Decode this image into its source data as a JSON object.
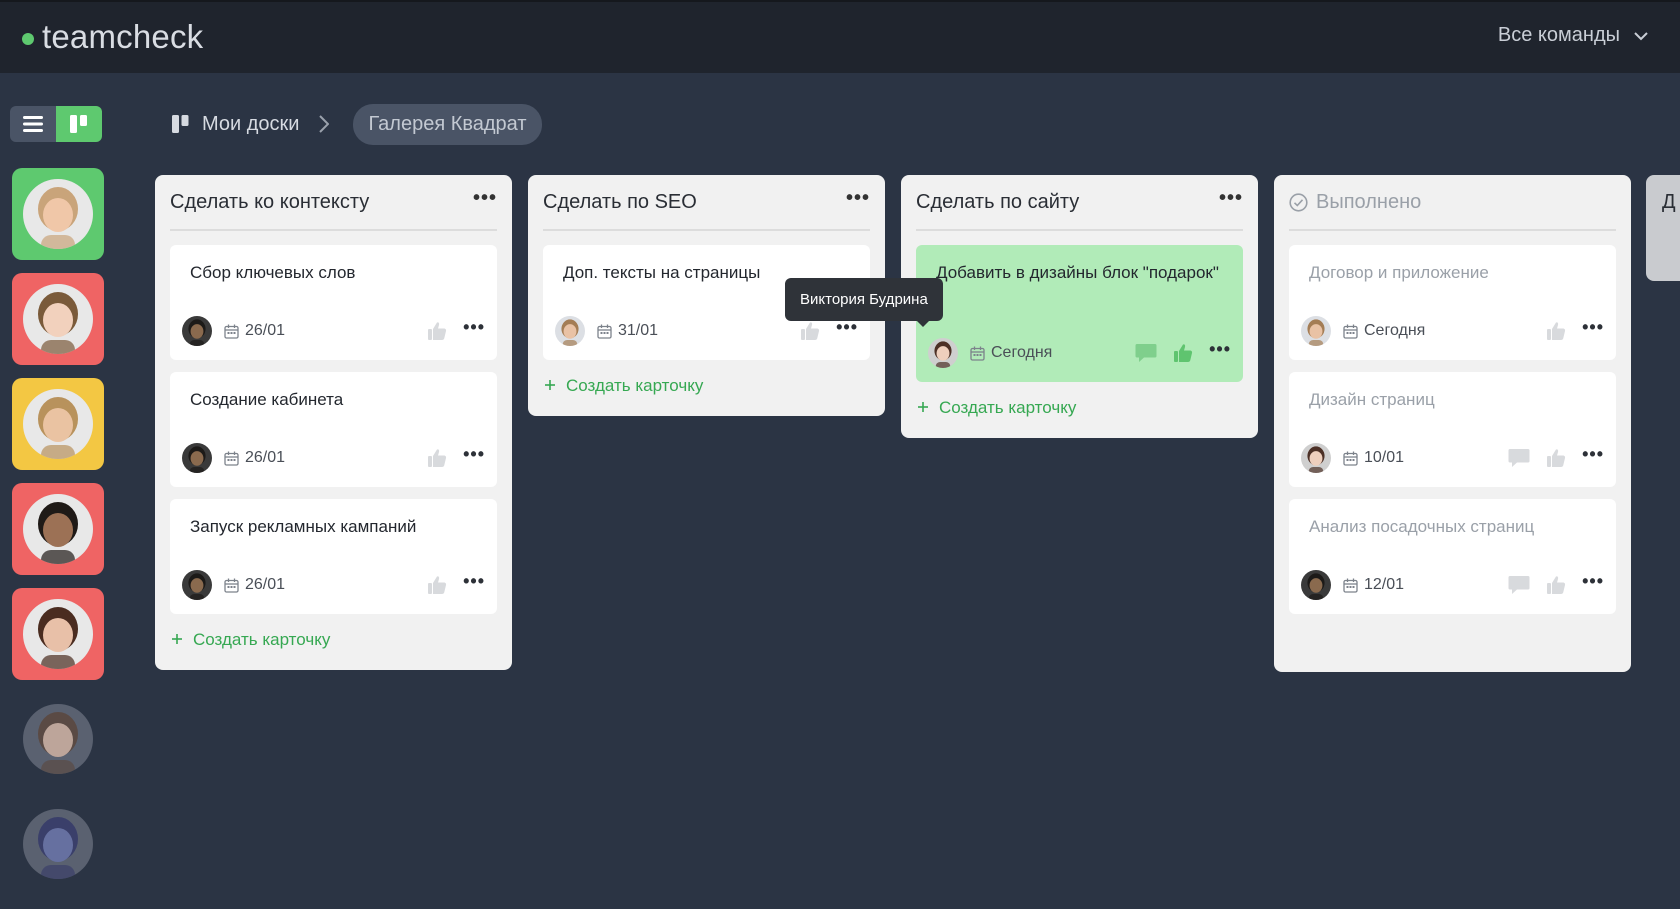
{
  "app": {
    "logo_text": "teamcheck",
    "team_select": "Все команды"
  },
  "colors": {
    "accent": "#5ec96f",
    "link_green": "#36a852",
    "bg": "#2b3444",
    "topbar": "#1f242d"
  },
  "breadcrumb": {
    "root": "Мои доски",
    "current": "Галерея Квадрат"
  },
  "sidebar_avatars": [
    {
      "tile": "#5ec96f",
      "skin": "#f0c7a8",
      "hair": "#c9a47a"
    },
    {
      "tile": "#ef6464",
      "skin": "#f2d1bd",
      "hair": "#7a5a3a"
    },
    {
      "tile": "#f3c743",
      "skin": "#eac3a2",
      "hair": "#b8925c"
    },
    {
      "tile": "#ef6464",
      "skin": "#9c7155",
      "hair": "#1f1a17"
    },
    {
      "tile": "#ef6464",
      "skin": "#e8c0a8",
      "hair": "#4a2c20"
    },
    {
      "tile": "",
      "skin": "#bda59a",
      "hair": "#5a4a44"
    },
    {
      "tile": "",
      "skin": "#6670a0",
      "hair": "#3a3f6a"
    }
  ],
  "columns": [
    {
      "title": "Сделать ко контексту",
      "add_label": "Создать карточку",
      "cards": [
        {
          "title": "Сбор ключевых слов",
          "date": "26/01",
          "avatar": "dark",
          "comment": false,
          "like_active": false
        },
        {
          "title": "Создание кабинета",
          "date": "26/01",
          "avatar": "dark",
          "comment": false,
          "like_active": false
        },
        {
          "title": "Запуск рекламных кампаний",
          "date": "26/01",
          "avatar": "dark",
          "comment": false,
          "like_active": false
        }
      ]
    },
    {
      "title": "Сделать по SEO",
      "add_label": "Создать карточку",
      "cards": [
        {
          "title": "Доп. тексты на страницы",
          "date": "31/01",
          "avatar": "light",
          "comment": false,
          "like_active": false
        }
      ]
    },
    {
      "title": "Сделать по сайту",
      "add_label": "Создать карточку",
      "cards": [
        {
          "title": "Добавить в дизайны блок \"подарок\"",
          "date": "Сегодня",
          "avatar": "girl",
          "comment": true,
          "like_active": true
        }
      ]
    },
    {
      "title": "Выполнено",
      "add_label": "",
      "cards": [
        {
          "title": "Договор и приложение",
          "date": "Сегодня",
          "avatar": "light",
          "comment": false,
          "like_active": false
        },
        {
          "title": "Дизайн страниц",
          "date": "10/01",
          "avatar": "girl",
          "comment": true,
          "like_active": false
        },
        {
          "title": "Анализ посадочных страниц",
          "date": "12/01",
          "avatar": "dark",
          "comment": true,
          "like_active": false
        }
      ]
    }
  ],
  "partial_column_title": "Д",
  "tooltip": "Виктория Будрина"
}
